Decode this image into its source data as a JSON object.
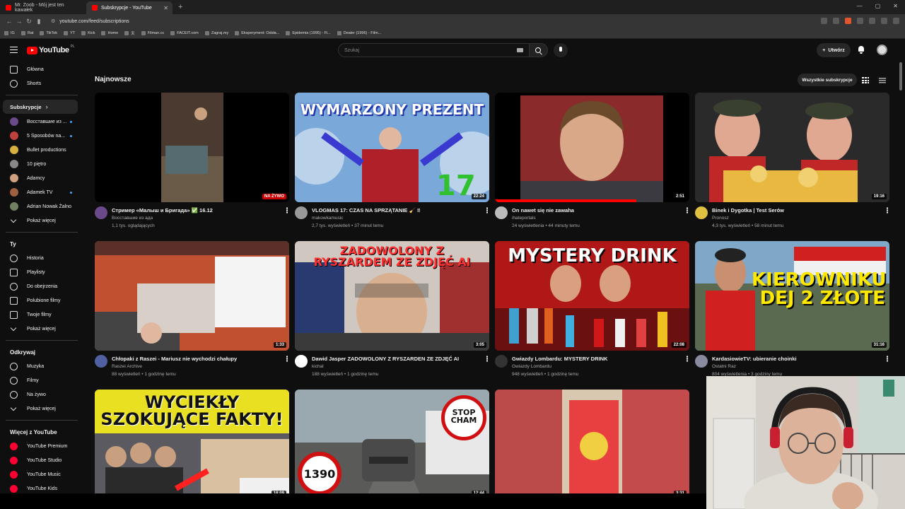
{
  "browser": {
    "tabs": [
      {
        "title": "Mr. Zoob - Mój jest ten kawałek",
        "active": false
      },
      {
        "title": "Subskrypcje - YouTube",
        "active": true
      }
    ],
    "url": "youtube.com/feed/subscriptions",
    "bookmarks": [
      "IG",
      "Rat",
      "TikTok",
      "YT",
      "Kick",
      "Home",
      "天",
      "Filman.cc",
      "FACEIT.com",
      "Zagraj.my",
      "Eksperyment: Odsła...",
      "Epidemia (1995) - Fi...",
      "Dealer (1996) - Film..."
    ]
  },
  "header": {
    "logo_text": "YouTube",
    "country_code": "PL",
    "search_placeholder": "Szukaj",
    "create_label": "Utwórz"
  },
  "sidebar": {
    "main": [
      {
        "label": "Główna",
        "icon": "home-icon"
      },
      {
        "label": "Shorts",
        "icon": "shorts-icon"
      }
    ],
    "subscriptions_header": "Subskrypcje",
    "subscriptions": [
      {
        "label": "Восставшие из ...",
        "color": "#6a4a8a",
        "new": true
      },
      {
        "label": "5 Sposobów na...",
        "color": "#c04040",
        "new": true
      },
      {
        "label": "Bullet productions",
        "color": "#d8b040",
        "new": false
      },
      {
        "label": "10 piętro",
        "color": "#888888",
        "new": false
      },
      {
        "label": "Adamcy",
        "color": "#d0a080",
        "new": false
      },
      {
        "label": "Adamek TV",
        "color": "#a06040",
        "new": true
      },
      {
        "label": "Adrian Nowak Żalno",
        "color": "#708060",
        "new": false
      }
    ],
    "show_more_1": "Pokaż więcej",
    "you_header": "Ty",
    "you": [
      {
        "label": "Historia",
        "icon": "history-icon"
      },
      {
        "label": "Playlisty",
        "icon": "playlists-icon"
      },
      {
        "label": "Do obejrzenia",
        "icon": "watch-later-icon"
      },
      {
        "label": "Polubione filmy",
        "icon": "liked-icon"
      },
      {
        "label": "Twoje filmy",
        "icon": "your-videos-icon"
      }
    ],
    "show_more_2": "Pokaż więcej",
    "explore_header": "Odkrywaj",
    "explore": [
      {
        "label": "Muzyka",
        "icon": "music-icon"
      },
      {
        "label": "Filmy",
        "icon": "films-icon"
      },
      {
        "label": "Na żywo",
        "icon": "live-icon"
      }
    ],
    "show_more_3": "Pokaż więcej",
    "more_header": "Więcej z YouTube",
    "more": [
      {
        "label": "YouTube Premium"
      },
      {
        "label": "YouTube Studio"
      },
      {
        "label": "YouTube Music"
      },
      {
        "label": "YouTube Kids"
      }
    ]
  },
  "main": {
    "section_title": "Najnowsze",
    "all_subscriptions_label": "Wszystkie subskrypcje",
    "videos": [
      {
        "title": "Стример «Малыш и Бригада» ✅ 16.12",
        "channel": "Восставшие из ада",
        "stats": "1,1 tys. oglądających",
        "duration": "NA ŻYWO",
        "live": true,
        "thumb_text": "",
        "bg": "#2a2420",
        "avatar": "#6a4a8a"
      },
      {
        "title": "VLOGMAS 17: CZAS NA SPRZĄTANIE 🧹 ‼",
        "channel": "makowkamusic",
        "stats": "2,7 tys. wyświetleń • 37 minut temu",
        "duration": "22:24",
        "live": false,
        "thumb_text": "WYMARZONY PREZENT",
        "bg": "#6a90c0",
        "avatar": "#999999"
      },
      {
        "title": "On nawet się nie zawaha",
        "channel": "ihateportals",
        "stats": "24 wyświetlenia • 44 minuty temu",
        "duration": "2:51",
        "live": false,
        "thumb_text": "",
        "bg": "#8a3030",
        "avatar": "#bbbbbb"
      },
      {
        "title": "Binek i Dygotka | Test Serów",
        "channel": "Pronosz",
        "stats": "4,3 tys. wyświetleń • 58 minut temu",
        "duration": "19:16",
        "live": false,
        "thumb_text": "",
        "bg": "#2a2a2a",
        "avatar": "#e0c040"
      },
      {
        "title": "Chłopaki z Raszei - Mariusz nie wychodzi chałupy",
        "channel": "Raszei Archive",
        "stats": "88 wyświetleń • 1 godzinę temu",
        "duration": "1:33",
        "live": false,
        "thumb_text": "",
        "bg": "#a04030",
        "avatar": "#5060a0"
      },
      {
        "title": "Dawid Jasper ZADOWOLONY Z RYSZARDEN ZE ZDJĘĆ AI",
        "channel": "kichal",
        "stats": "188 wyświetleń • 1 godzinę temu",
        "duration": "3:05",
        "live": false,
        "thumb_text": "ZADOWOLONY Z RYSZARDEM ZE ZDJĘĆ AI",
        "bg": "#a02830",
        "avatar": "#ffffff"
      },
      {
        "title": "Gwiazdy Lombardu: MYSTERY DRINK",
        "channel": "Gwiazdy Lombardu",
        "stats": "948 wyświetleń • 1 godzinę temu",
        "duration": "22:08",
        "live": false,
        "thumb_text": "MYSTERY DRINK",
        "bg": "#b02020",
        "avatar": "#333333"
      },
      {
        "title": "KardasiowieTV: ubieranie choinki",
        "channel": "Ostatni Raz",
        "stats": "804 wyświetlenia • 3 godziny temu",
        "duration": "31:16",
        "live": false,
        "thumb_text": "KIEROWNIKU DEJ 2 ZŁOTE",
        "bg": "#3a3a3a",
        "avatar": "#8a8aa0"
      },
      {
        "title": "",
        "channel": "",
        "stats": "",
        "duration": "18:09",
        "live": false,
        "thumb_text": "WYCIEKŁY SZOKUJĄCE FAKTY!",
        "bg": "#e8e020",
        "avatar": ""
      },
      {
        "title": "",
        "channel": "",
        "stats": "",
        "duration": "12:44",
        "live": false,
        "thumb_text": "STOP CHAM",
        "bg": "#7a8a90",
        "avatar": ""
      },
      {
        "title": "",
        "channel": "",
        "stats": "",
        "duration": "3:31",
        "live": false,
        "thumb_text": "",
        "bg": "#c04a4a",
        "avatar": ""
      }
    ],
    "sign_1390": "1390"
  }
}
